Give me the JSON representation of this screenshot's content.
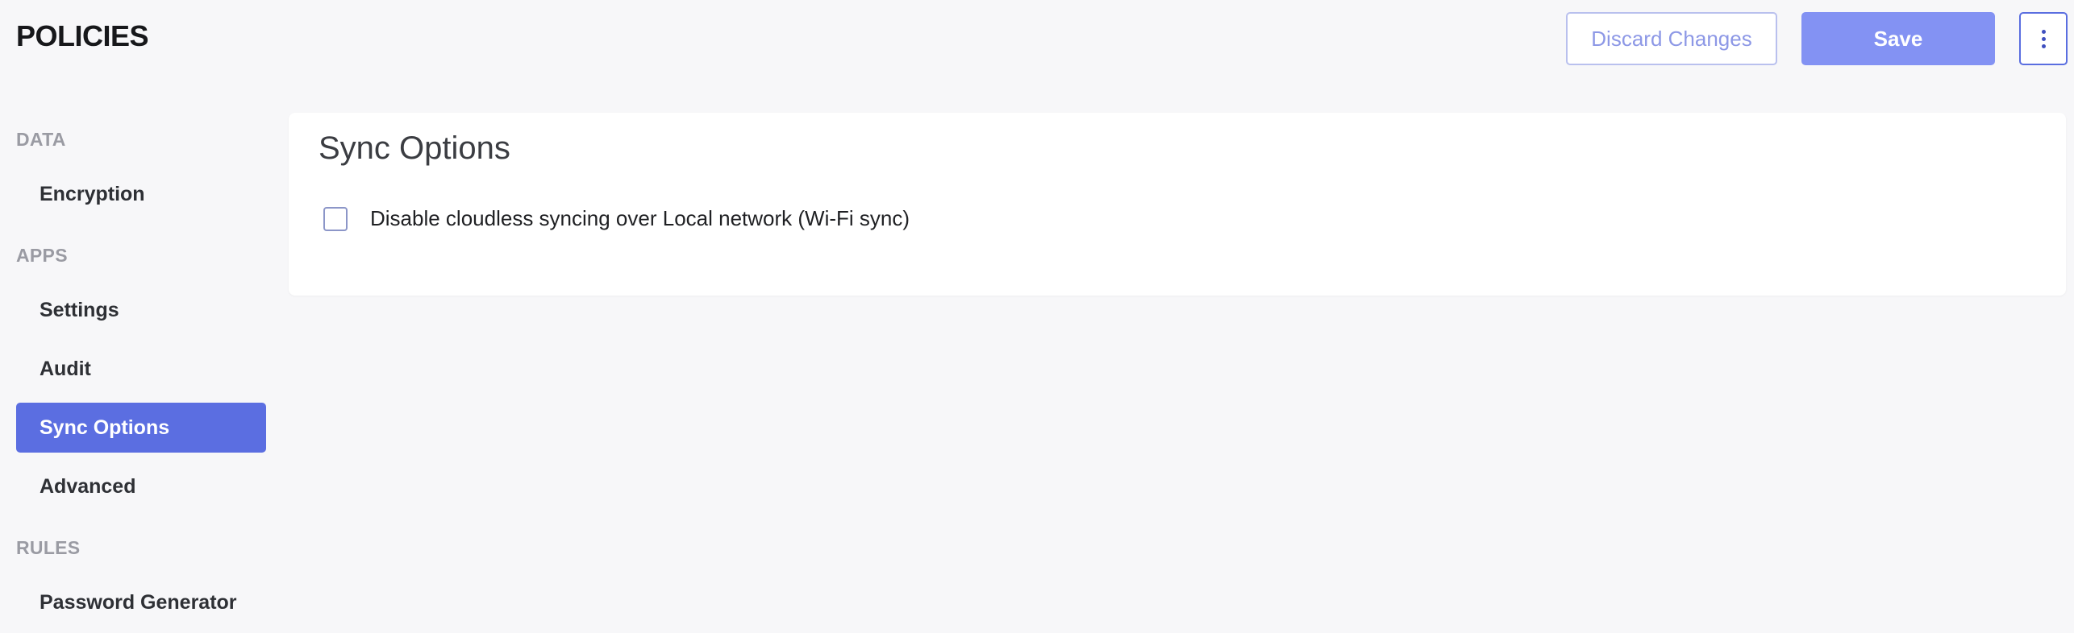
{
  "header": {
    "title": "POLICIES",
    "discard_label": "Discard Changes",
    "save_label": "Save",
    "more_icon": "kebab-vertical-icon"
  },
  "sidebar": {
    "sections": [
      {
        "label": "DATA",
        "items": [
          {
            "label": "Encryption",
            "active": false
          }
        ]
      },
      {
        "label": "APPS",
        "items": [
          {
            "label": "Settings",
            "active": false
          },
          {
            "label": "Audit",
            "active": false
          },
          {
            "label": "Sync Options",
            "active": true
          },
          {
            "label": "Advanced",
            "active": false
          }
        ]
      },
      {
        "label": "RULES",
        "items": [
          {
            "label": "Password Generator",
            "active": false
          }
        ]
      }
    ]
  },
  "main": {
    "title": "Sync Options",
    "option": {
      "label": "Disable cloudless syncing over Local network (Wi-Fi sync)",
      "checked": false
    }
  },
  "colors": {
    "accent": "#5b6ee1",
    "save_button": "#8392f3",
    "background": "#f7f7f9"
  }
}
